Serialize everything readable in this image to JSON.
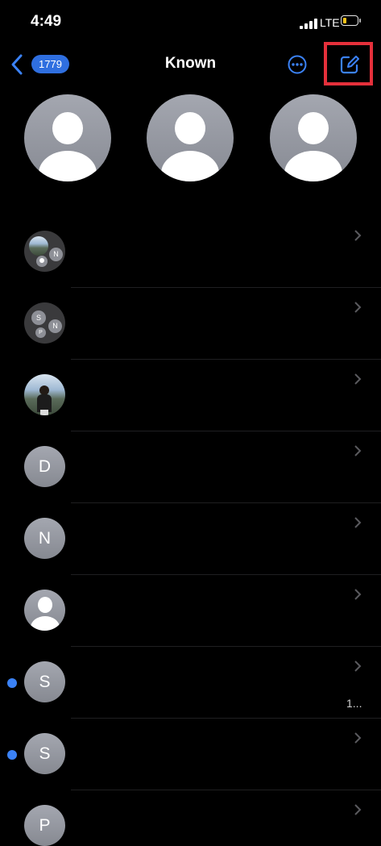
{
  "status_bar": {
    "time": "4:49",
    "network": "LTE",
    "battery_color": "#f4c21a"
  },
  "nav": {
    "back_count": "1779",
    "title": "Known",
    "accent": "#2f6fe0",
    "highlight_color": "#e5303b"
  },
  "pinned": [
    {
      "icon": "person-placeholder"
    },
    {
      "icon": "person-placeholder"
    },
    {
      "icon": "person-placeholder"
    }
  ],
  "conversations": [
    {
      "avatar": "group",
      "unread": false,
      "members": [
        "photo",
        "person",
        "N"
      ]
    },
    {
      "avatar": "group",
      "unread": false,
      "members": [
        "S",
        "P",
        "N"
      ]
    },
    {
      "avatar": "photo",
      "unread": false
    },
    {
      "avatar": "letter",
      "initial": "D",
      "unread": false
    },
    {
      "avatar": "letter",
      "initial": "N",
      "unread": false
    },
    {
      "avatar": "person",
      "unread": false
    },
    {
      "avatar": "letter",
      "initial": "S",
      "unread": true,
      "preview": "1..."
    },
    {
      "avatar": "letter",
      "initial": "S",
      "unread": true
    },
    {
      "avatar": "letter",
      "initial": "P",
      "unread": false
    }
  ]
}
